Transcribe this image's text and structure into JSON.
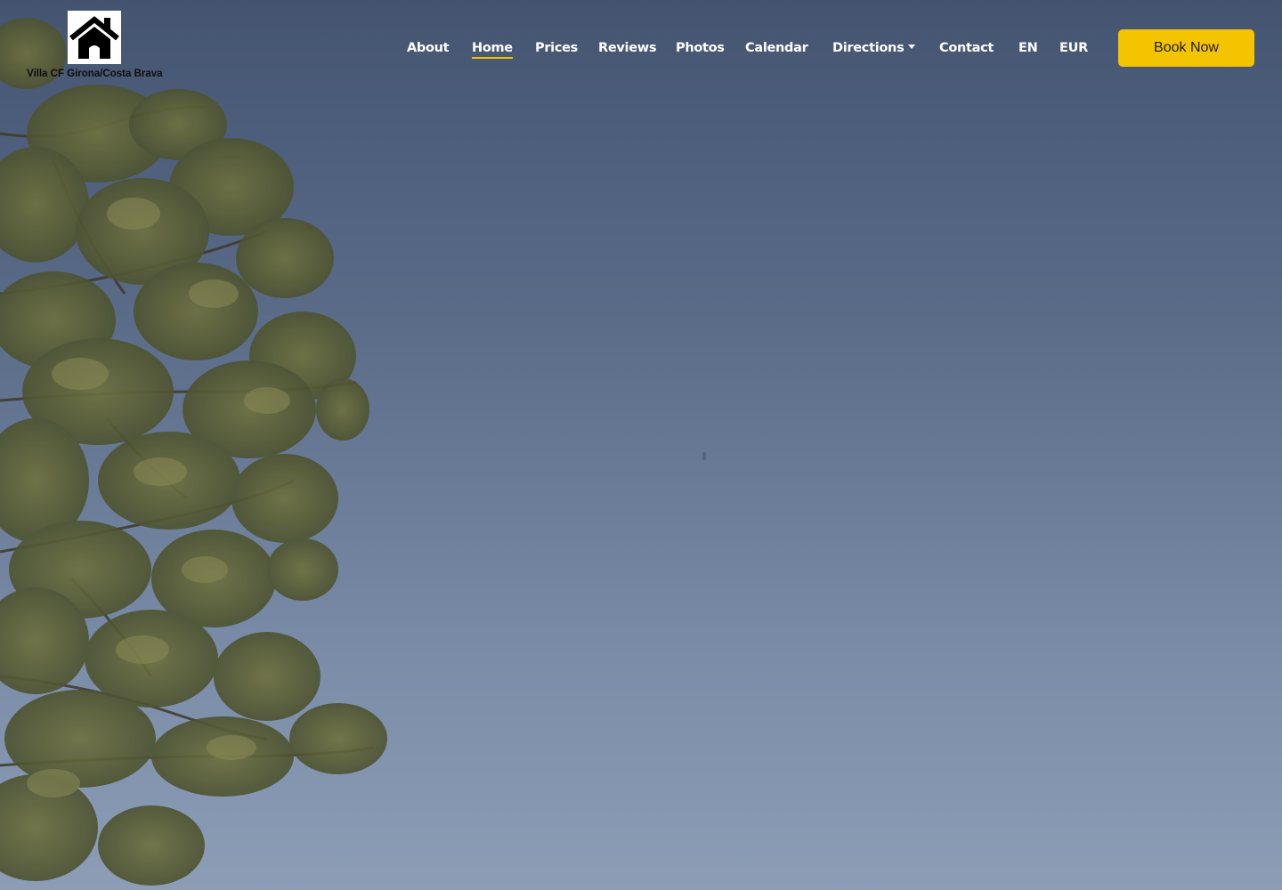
{
  "site": {
    "name": "Villa CF Girona/Costa Brava",
    "logo_icon": "house-icon"
  },
  "nav": {
    "items": [
      {
        "label": "About",
        "active": false
      },
      {
        "label": "Home",
        "active": true
      },
      {
        "label": "Prices",
        "active": false
      },
      {
        "label": "Reviews",
        "active": false
      },
      {
        "label": "Photos",
        "active": false
      },
      {
        "label": "Calendar",
        "active": false
      },
      {
        "label": "Directions",
        "active": false,
        "has_dropdown": true
      },
      {
        "label": "Contact",
        "active": false
      }
    ],
    "language": "EN",
    "currency": "EUR",
    "cta_label": "Book Now"
  },
  "colors": {
    "accent": "#f5c400",
    "nav_text": "#ffffff",
    "sky_top": "#445470",
    "sky_bottom": "#8d9db6"
  }
}
